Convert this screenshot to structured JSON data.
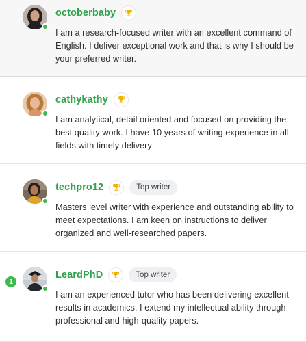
{
  "writers": [
    {
      "username": "octoberbaby",
      "badge": "",
      "bio": "I am a research-focused writer with an excellent command of English. I deliver exceptional work and that is why I should be your preferred writer.",
      "online": true
    },
    {
      "username": "cathykathy",
      "badge": "",
      "bio": "I am analytical, detail oriented and focused on providing the best quality work. I have 10 years of writing experience in all fields with timely delivery",
      "online": true
    },
    {
      "username": "techpro12",
      "badge": "Top writer",
      "bio": "Masters level writer with experience and outstanding ability to meet expectations. I am keen on instructions to deliver organized and well-researched papers.",
      "online": true
    },
    {
      "username": "LeardPhD",
      "badge": "Top writer",
      "bio": "I am an experienced tutor who has been delivering excellent results in academics, I extend my intellectual ability through professional and high-quality papers.",
      "online": true,
      "counter": "1"
    }
  ],
  "colors": {
    "accent": "#2fa24c",
    "online": "#3fb950",
    "trophy": "#f0b400"
  },
  "icons": [
    "trophy-icon",
    "online-status-icon"
  ]
}
